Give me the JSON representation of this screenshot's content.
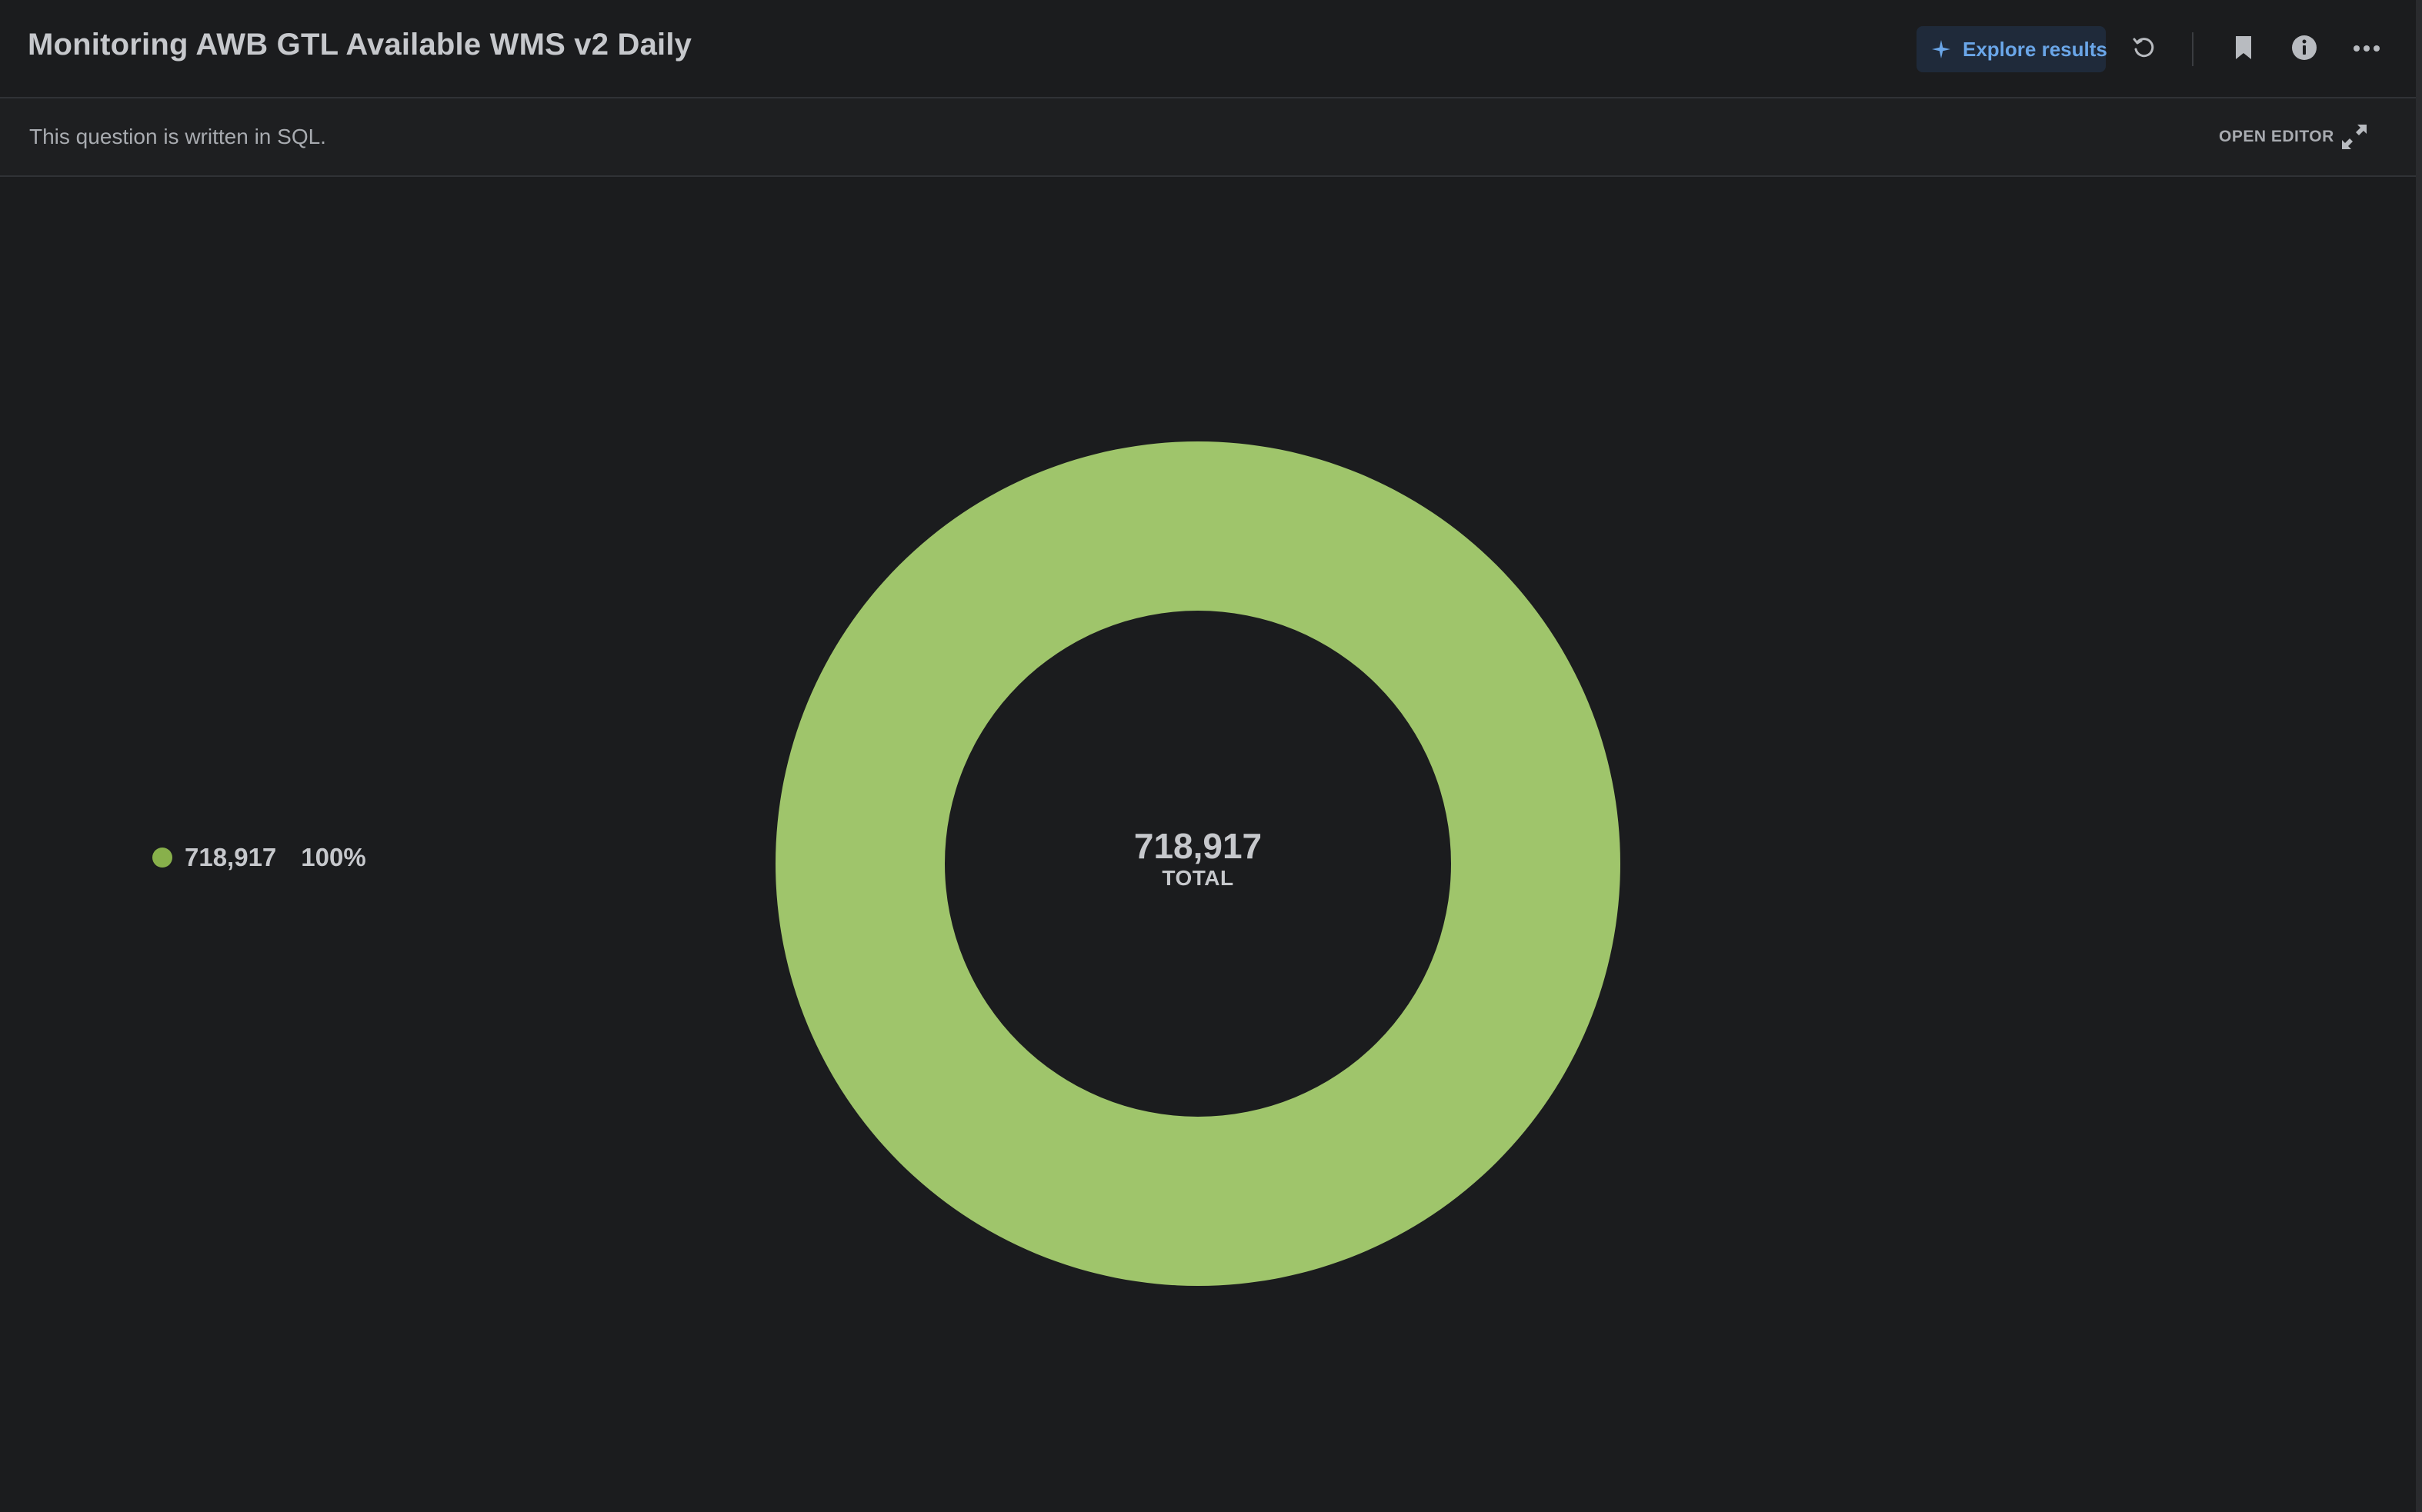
{
  "header": {
    "title": "Monitoring AWB GTL Available WMS v2 Daily",
    "explore_label": "Explore results",
    "icons": [
      "sparkle-icon",
      "refresh-icon",
      "bookmark-icon",
      "info-icon",
      "more-icon"
    ]
  },
  "subheader": {
    "note": "This question is written in SQL.",
    "open_editor_label": "OPEN EDITOR",
    "expand_icon": "expand-icon"
  },
  "colors": {
    "accent": "#6aa6e8",
    "slice": "#9fc56b",
    "legend_dot": "#88b04b",
    "background": "#1b1c1e"
  },
  "chart_data": {
    "type": "pie",
    "variant": "donut",
    "slices": [
      {
        "label": "718,917",
        "value": 718917,
        "percent": "100%"
      }
    ],
    "legend": {
      "placement": "left",
      "entries": [
        {
          "value_label": "718,917",
          "percent": "100%"
        }
      ]
    },
    "center": {
      "value": "718,917",
      "caption": "TOTAL"
    }
  }
}
